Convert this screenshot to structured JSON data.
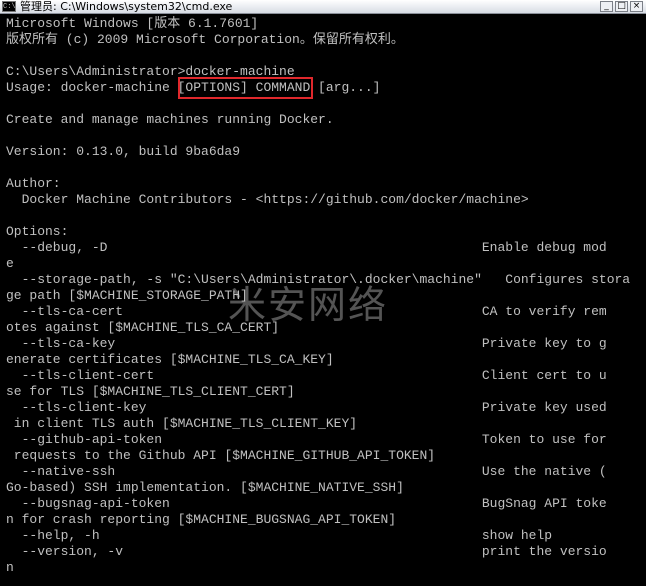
{
  "window": {
    "title": "管理员: C:\\Windows\\system32\\cmd.exe",
    "icon_label": "C:\\",
    "controls": {
      "minimize": "_",
      "maximize": "□",
      "close": "×"
    }
  },
  "terminal": {
    "lines": [
      "Microsoft Windows [版本 6.1.7601]",
      "版权所有 (c) 2009 Microsoft Corporation。保留所有权利。",
      "",
      "C:\\Users\\Administrator>docker-machine",
      "Usage: docker-machine [OPTIONS] COMMAND [arg...]",
      "",
      "Create and manage machines running Docker.",
      "",
      "Version: 0.13.0, build 9ba6da9",
      "",
      "Author:",
      "  Docker Machine Contributors - <https://github.com/docker/machine>",
      "",
      "Options:",
      "  --debug, -D                                                Enable debug mod",
      "e",
      "  --storage-path, -s \"C:\\Users\\Administrator\\.docker\\machine\"   Configures stora",
      "ge path [$MACHINE_STORAGE_PATH]",
      "  --tls-ca-cert                                              CA to verify rem",
      "otes against [$MACHINE_TLS_CA_CERT]",
      "  --tls-ca-key                                               Private key to g",
      "enerate certificates [$MACHINE_TLS_CA_KEY]",
      "  --tls-client-cert                                          Client cert to u",
      "se for TLS [$MACHINE_TLS_CLIENT_CERT]",
      "  --tls-client-key                                           Private key used",
      " in client TLS auth [$MACHINE_TLS_CLIENT_KEY]",
      "  --github-api-token                                         Token to use for",
      " requests to the Github API [$MACHINE_GITHUB_API_TOKEN]",
      "  --native-ssh                                               Use the native (",
      "Go-based) SSH implementation. [$MACHINE_NATIVE_SSH]",
      "  --bugsnag-api-token                                        BugSnag API toke",
      "n for crash reporting [$MACHINE_BUGSNAG_API_TOKEN]",
      "  --help, -h                                                 show help",
      "  --version, -v                                              print the versio",
      "n"
    ]
  },
  "watermark": "米安网络",
  "colors": {
    "background": "#000000",
    "text": "#c0c0c0",
    "highlight_border": "#e0282c"
  }
}
